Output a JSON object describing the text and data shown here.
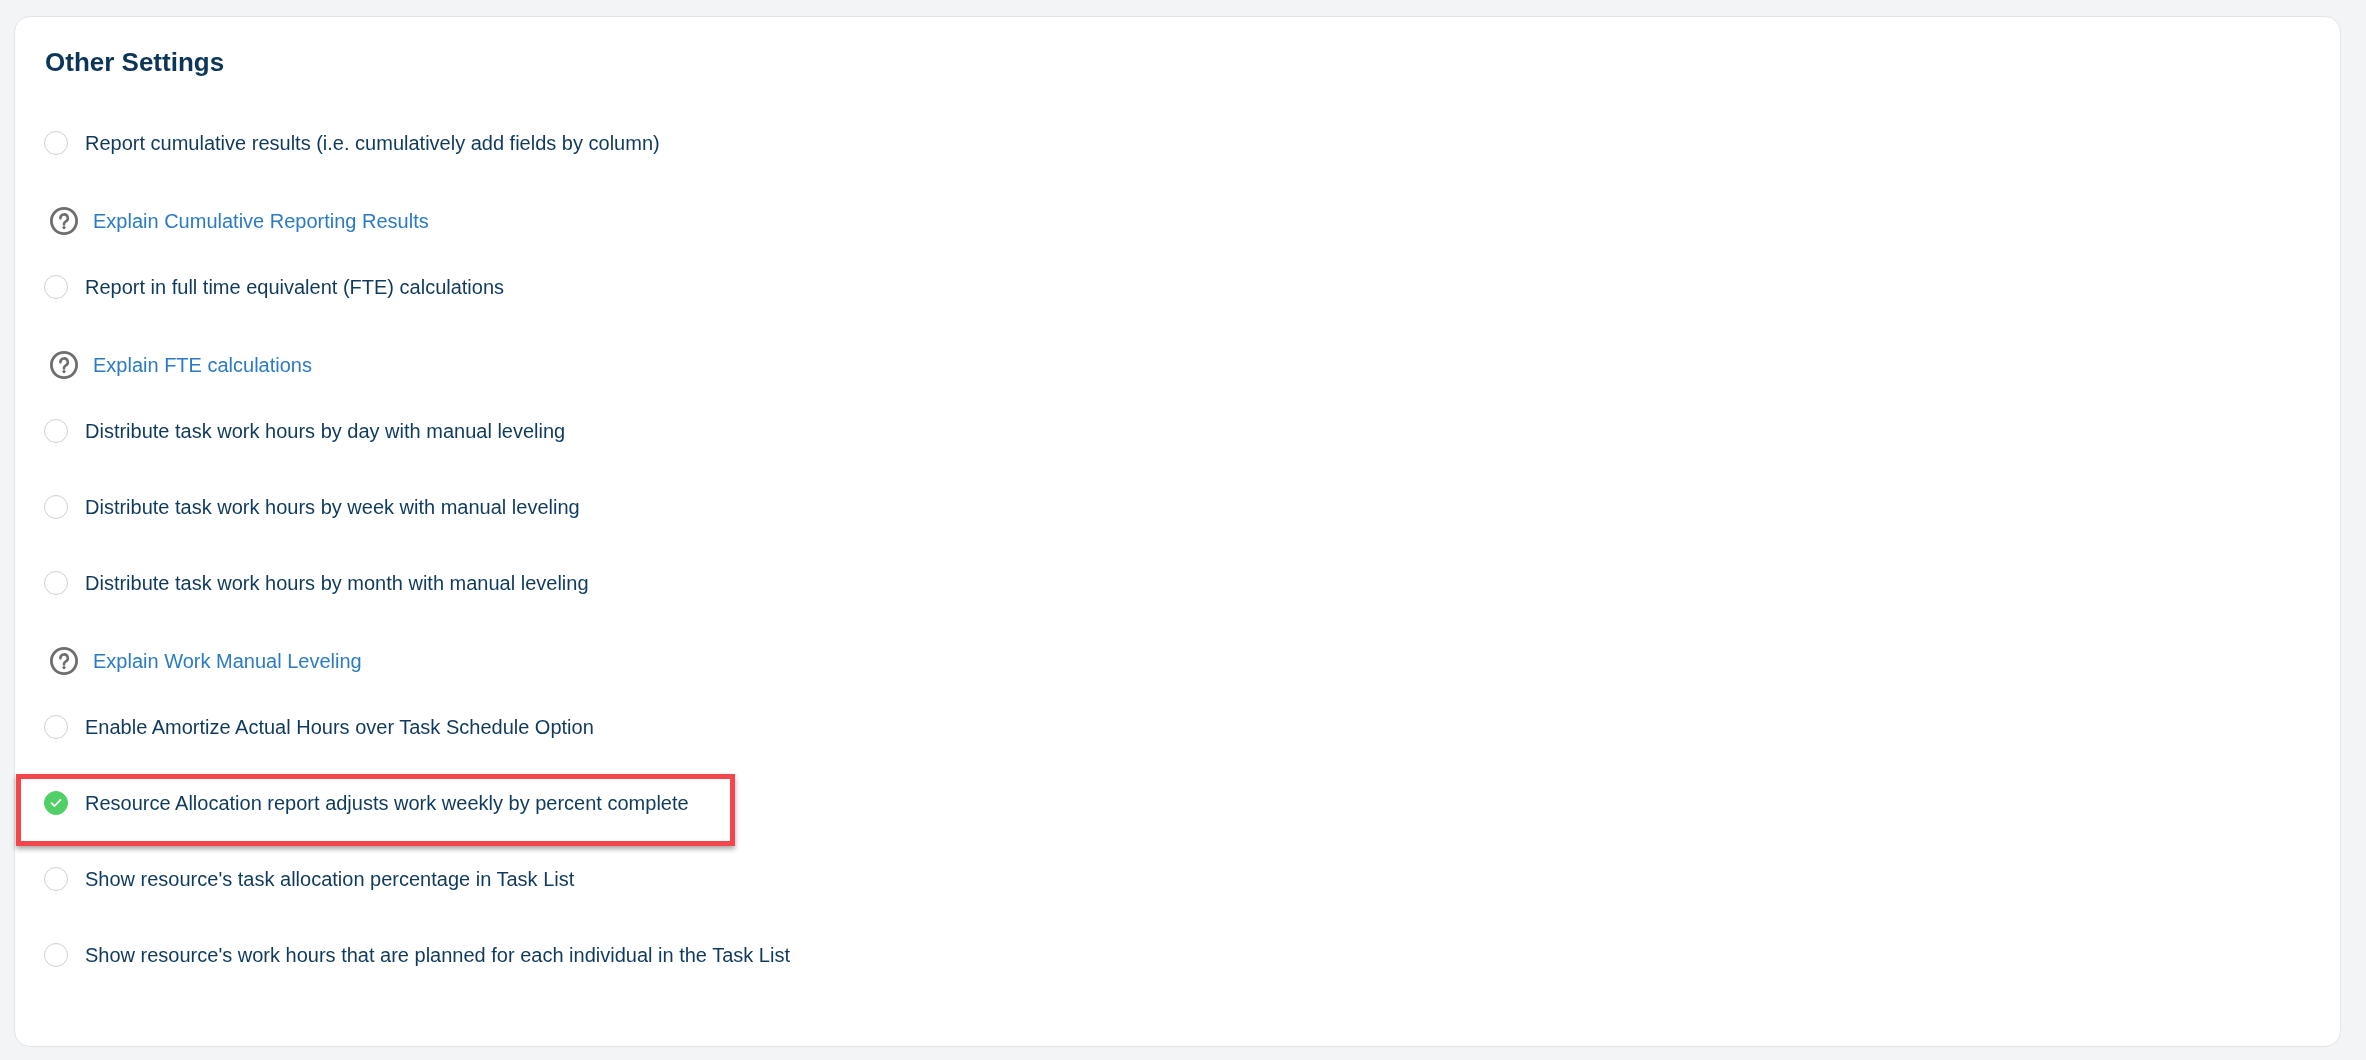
{
  "section": {
    "title": "Other Settings"
  },
  "settings": [
    {
      "label": "Report cumulative results (i.e. cumulatively add fields by column)",
      "checked": false,
      "highlighted": false,
      "help": "Explain Cumulative Reporting Results"
    },
    {
      "label": "Report in full time equivalent (FTE) calculations",
      "checked": false,
      "highlighted": false,
      "help": "Explain FTE calculations"
    },
    {
      "label": "Distribute task work hours by day with manual leveling",
      "checked": false,
      "highlighted": false
    },
    {
      "label": "Distribute task work hours by week with manual leveling",
      "checked": false,
      "highlighted": false
    },
    {
      "label": "Distribute task work hours by month with manual leveling",
      "checked": false,
      "highlighted": false,
      "help": "Explain Work Manual Leveling"
    },
    {
      "label": "Enable Amortize Actual Hours over Task Schedule Option",
      "checked": false,
      "highlighted": false
    },
    {
      "label": "Resource Allocation report adjusts work weekly by percent complete",
      "checked": true,
      "highlighted": true
    },
    {
      "label": "Show resource's task allocation percentage in Task List",
      "checked": false,
      "highlighted": false
    },
    {
      "label": "Show resource's work hours that are planned for each individual in the Task List",
      "checked": false,
      "highlighted": false
    }
  ]
}
